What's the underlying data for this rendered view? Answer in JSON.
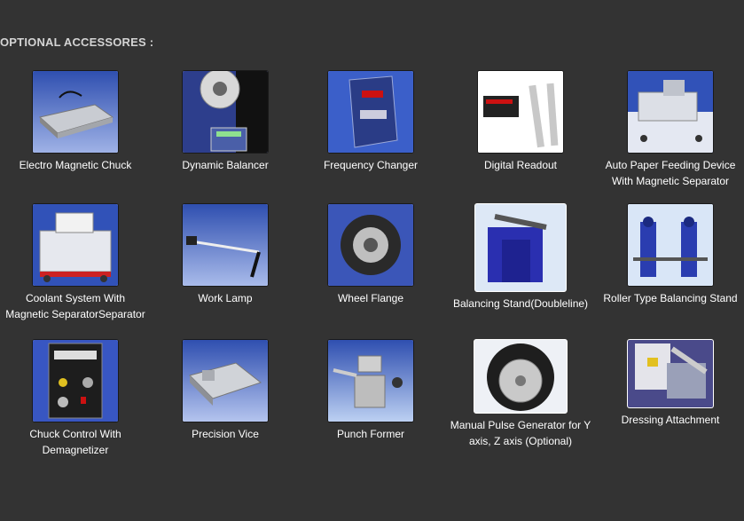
{
  "section": {
    "title": "OPTIONAL ACCESSORES :"
  },
  "items": [
    {
      "label": "Electro Magnetic Chuck",
      "icon": "electro-magnetic-chuck-image"
    },
    {
      "label": "Dynamic Balancer",
      "icon": "dynamic-balancer-image"
    },
    {
      "label": "Frequency Changer",
      "icon": "frequency-changer-image"
    },
    {
      "label": "Digital Readout",
      "icon": "digital-readout-image"
    },
    {
      "label": "Auto Paper Feeding Device With Magnetic Separator",
      "icon": "auto-paper-feeding-image"
    },
    {
      "label": "Coolant System With Magnetic SeparatorSeparator",
      "icon": "coolant-system-image"
    },
    {
      "label": "Work Lamp",
      "icon": "work-lamp-image"
    },
    {
      "label": "Wheel Flange",
      "icon": "wheel-flange-image"
    },
    {
      "label": "Balancing Stand(Doubleline)",
      "icon": "balancing-stand-image"
    },
    {
      "label": "Roller Type Balancing Stand",
      "icon": "roller-balancing-stand-image"
    },
    {
      "label": "Chuck Control With Demagnetizer",
      "icon": "chuck-control-image"
    },
    {
      "label": "Precision Vice",
      "icon": "precision-vice-image"
    },
    {
      "label": "Punch Former",
      "icon": "punch-former-image"
    },
    {
      "label": "Manual Pulse Generator for Y axis, Z axis (Optional)",
      "icon": "manual-pulse-generator-image"
    },
    {
      "label": "Dressing Attachment",
      "icon": "dressing-attachment-image"
    }
  ],
  "colors": {
    "background": "#333333",
    "heading": "#d4d4d4",
    "caption": "#ffffff",
    "thumb_blue": "#3a4fa8"
  }
}
